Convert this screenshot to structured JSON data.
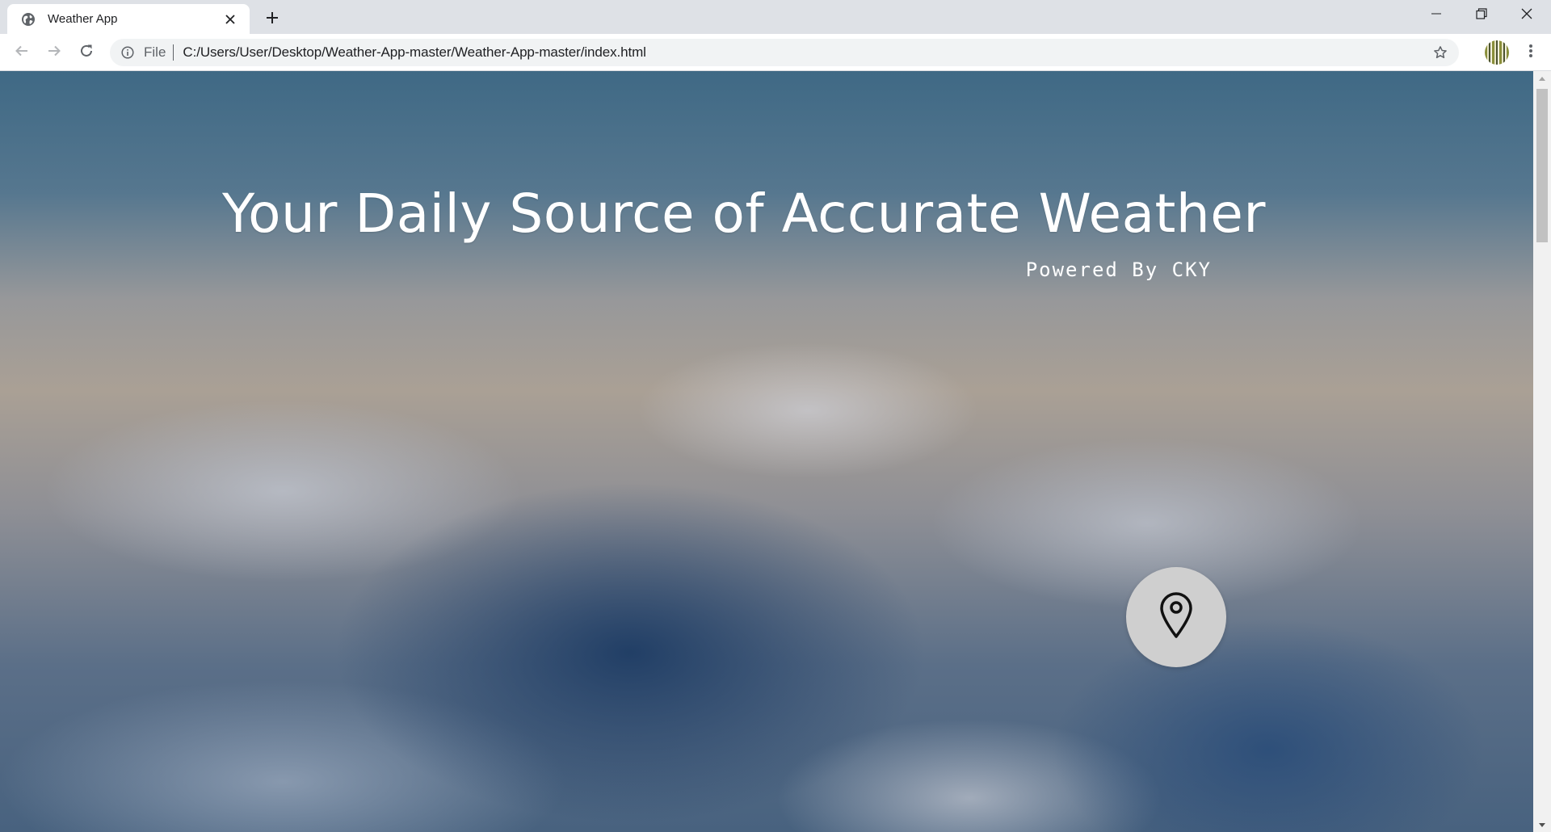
{
  "browser": {
    "tab": {
      "title": "Weather App"
    },
    "address": {
      "scheme_label": "File",
      "url": "C:/Users/User/Desktop/Weather-App-master/Weather-App-master/index.html"
    }
  },
  "page": {
    "headline": "Your Daily Source of Accurate Weather",
    "subtitle": "Powered By CKY"
  },
  "icons": {
    "favicon": "globe-icon",
    "tab_close": "close-icon",
    "new_tab": "plus-icon",
    "minimize": "minimize-icon",
    "restore": "restore-icon",
    "close_window": "close-icon",
    "back": "back-arrow-icon",
    "forward": "forward-arrow-icon",
    "reload": "reload-icon",
    "site_info": "info-icon",
    "bookmark": "star-icon",
    "menu": "kebab-menu-icon",
    "locate": "map-pin-icon"
  },
  "colors": {
    "tabstrip_bg": "#dee1e6",
    "omnibox_bg": "#f1f3f4",
    "locate_button_bg": "#cfcfcf",
    "headline_text": "#ffffff"
  }
}
